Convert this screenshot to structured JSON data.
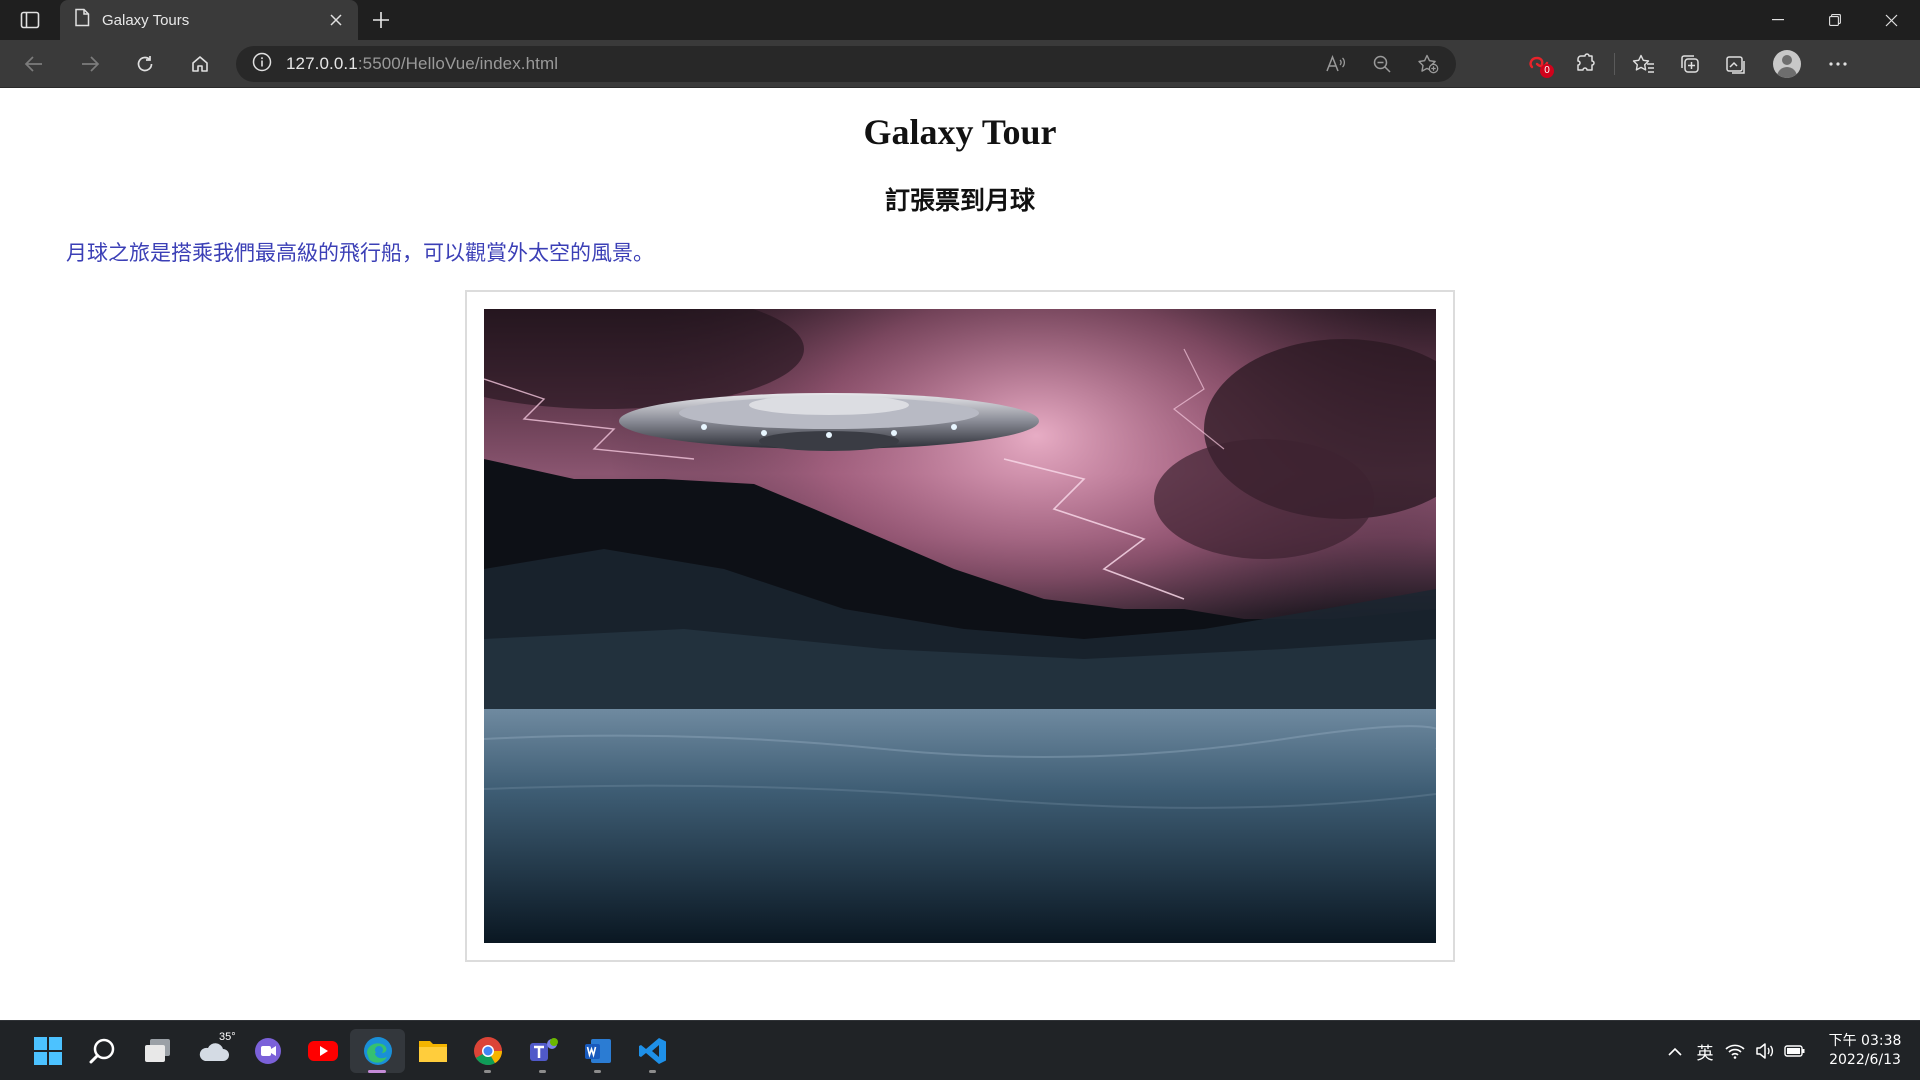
{
  "browser": {
    "tab": {
      "title": "Galaxy Tours",
      "icon": "page-icon"
    },
    "url_host": "127.0.0.1",
    "url_rest": ":5500/HelloVue/index.html",
    "extension_badge": "0"
  },
  "page": {
    "title": "Galaxy Tour",
    "subtitle": "訂張票到月球",
    "description": "月球之旅是搭乘我們最高級的飛行船，可以觀賞外太空的風景。",
    "description_color": "#3b3fb6",
    "image": "ufo-over-lake-photo"
  },
  "taskbar": {
    "weather_temp": "35°",
    "language": "英",
    "clock_time": "下午 03:38",
    "clock_date": "2022/6/13",
    "apps": [
      "start",
      "search",
      "task-view",
      "weather",
      "teams-chat",
      "youtube",
      "edge",
      "file-explorer",
      "chrome",
      "teams",
      "word",
      "vscode"
    ]
  }
}
